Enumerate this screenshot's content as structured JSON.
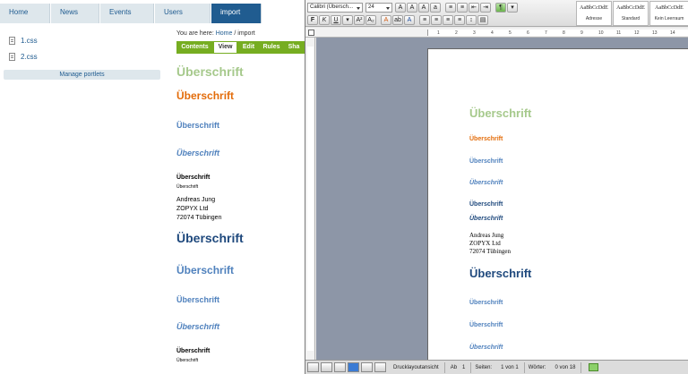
{
  "plone": {
    "nav": [
      "Home",
      "News",
      "Events",
      "Users",
      "import"
    ],
    "files": [
      "1.css",
      "2.css"
    ],
    "manage_portlets": "Manage portlets",
    "breadcrumb": {
      "prefix": "You are here:",
      "home": "Home",
      "sep": "/",
      "current": "import"
    },
    "tabs": [
      "Contents",
      "View",
      "Edit",
      "Rules",
      "Sha"
    ],
    "heading": "Überschrift",
    "address": [
      "Andreas Jung",
      "ZOPYX Ltd",
      "72074 Tübingen"
    ]
  },
  "word": {
    "font_name": "Calibri (Übersch...",
    "font_size": "24",
    "styles": [
      {
        "preview": "AaBbCcDdE",
        "name": "Adresse"
      },
      {
        "preview": "AaBbCcDdE",
        "name": "Standard"
      },
      {
        "preview": "AaBbCcDdE",
        "name": "Kein Leerraum"
      }
    ],
    "ruler_numbers": [
      "1",
      "2",
      "3",
      "4",
      "5",
      "6",
      "7",
      "8",
      "9",
      "10",
      "11",
      "12",
      "13",
      "14"
    ],
    "heading": "Überschrift",
    "address": [
      "Andreas Jung",
      "ZOPYX Ltd",
      "72074 Tübingen"
    ],
    "status": {
      "view": "Drucklayoutansicht",
      "section_label": "Ab",
      "section_value": "1",
      "pages_label": "Seiten:",
      "pages_value": "1 von 1",
      "words_label": "Wörter:",
      "words_value": "0 von 18"
    }
  },
  "colors": {
    "plone_blue": "#205c90",
    "plone_green": "#76ad21",
    "heading_lightgreen": "#a6c98c",
    "heading_orange": "#e36c0a",
    "heading_blue": "#4f81bd",
    "heading_darkblue": "#1f497d"
  }
}
